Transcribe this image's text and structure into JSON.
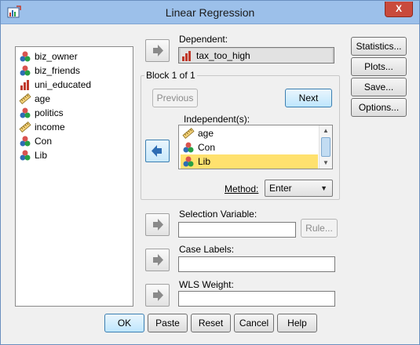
{
  "window": {
    "title": "Linear Regression",
    "close_label": "X"
  },
  "variables": [
    {
      "name": "biz_owner",
      "icon": "nominal-icon"
    },
    {
      "name": "biz_friends",
      "icon": "nominal-icon"
    },
    {
      "name": "uni_educated",
      "icon": "ordinal-icon"
    },
    {
      "name": "age",
      "icon": "scale-icon"
    },
    {
      "name": "politics",
      "icon": "nominal-icon"
    },
    {
      "name": "income",
      "icon": "scale-icon"
    },
    {
      "name": "Con",
      "icon": "nominal-icon"
    },
    {
      "name": "Lib",
      "icon": "nominal-icon"
    }
  ],
  "dependent": {
    "label": "Dependent:",
    "value": "tax_too_high",
    "icon": "ordinal-icon"
  },
  "block": {
    "label": "Block 1 of 1",
    "previous_label": "Previous",
    "next_label": "Next",
    "independents_label": "Independent(s):",
    "independents": [
      {
        "name": "age",
        "icon": "scale-icon",
        "selected": false
      },
      {
        "name": "Con",
        "icon": "nominal-icon",
        "selected": false
      },
      {
        "name": "Lib",
        "icon": "nominal-icon",
        "selected": true
      }
    ],
    "method_label": "Method:",
    "method_value": "Enter"
  },
  "selection": {
    "label": "Selection Variable:",
    "rule_label": "Rule..."
  },
  "case_labels": {
    "label": "Case Labels:"
  },
  "wls": {
    "label": "WLS Weight:"
  },
  "side_buttons": {
    "statistics": "Statistics...",
    "plots": "Plots...",
    "save": "Save...",
    "options": "Options..."
  },
  "bottom_buttons": {
    "ok": "OK",
    "paste": "Paste",
    "reset": "Reset",
    "cancel": "Cancel",
    "help": "Help"
  }
}
